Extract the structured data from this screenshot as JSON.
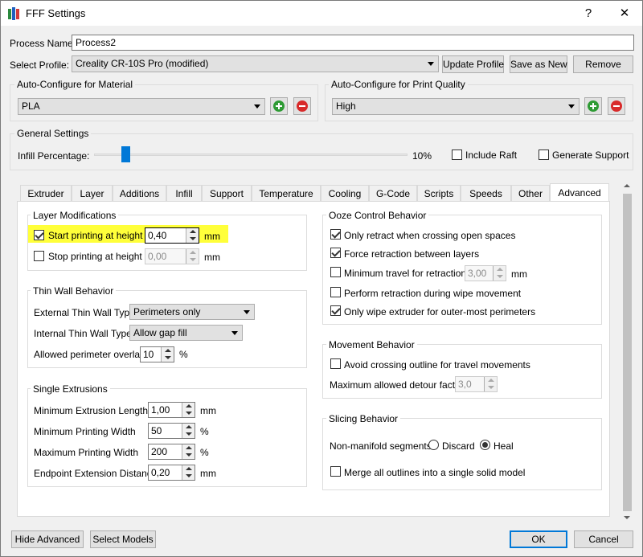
{
  "window": {
    "title": "FFF Settings",
    "help_label": "?",
    "close_label": "✕",
    "icon": "app-logo-icon"
  },
  "process": {
    "name_label": "Process Name:",
    "name_value": "Process2"
  },
  "profile": {
    "label": "Select Profile:",
    "value": "Creality CR-10S Pro (modified)",
    "update_label": "Update Profile",
    "save_as_label": "Save as New",
    "remove_label": "Remove"
  },
  "material": {
    "group_title": "Auto-Configure for Material",
    "value": "PLA"
  },
  "quality": {
    "group_title": "Auto-Configure for Print Quality",
    "value": "High"
  },
  "general": {
    "group_title": "General Settings",
    "infill_label": "Infill Percentage:",
    "infill_value": "10%",
    "infill_fraction": 0.1,
    "raft_label": "Include Raft",
    "raft_checked": false,
    "support_label": "Generate Support",
    "support_checked": false
  },
  "tabs": [
    "Extruder",
    "Layer",
    "Additions",
    "Infill",
    "Support",
    "Temperature",
    "Cooling",
    "G-Code",
    "Scripts",
    "Speeds",
    "Other",
    "Advanced"
  ],
  "active_tab": "Advanced",
  "layer_mod": {
    "title": "Layer Modifications",
    "start_label": "Start printing at height",
    "start_checked": true,
    "start_value": "0,40",
    "stop_label": "Stop printing at height",
    "stop_checked": false,
    "stop_value": "0,00",
    "unit": "mm"
  },
  "thin_wall": {
    "title": "Thin Wall Behavior",
    "external_label": "External Thin Wall Type",
    "external_value": "Perimeters only",
    "internal_label": "Internal Thin Wall Type",
    "internal_value": "Allow gap fill",
    "overlap_label": "Allowed perimeter overlap",
    "overlap_value": "10",
    "overlap_unit": "%"
  },
  "single": {
    "title": "Single Extrusions",
    "rows": [
      {
        "label": "Minimum Extrusion Length",
        "value": "1,00",
        "unit": "mm"
      },
      {
        "label": "Minimum Printing Width",
        "value": "50",
        "unit": "%"
      },
      {
        "label": "Maximum Printing Width",
        "value": "200",
        "unit": "%"
      },
      {
        "label": "Endpoint Extension Distance",
        "value": "0,20",
        "unit": "mm"
      }
    ]
  },
  "ooze": {
    "title": "Ooze Control Behavior",
    "only_retract": "Only retract when crossing open spaces",
    "force_retract": "Force retraction between layers",
    "min_travel": "Minimum travel for retraction",
    "min_travel_value": "3,00",
    "min_travel_unit": "mm",
    "perform_wipe": "Perform retraction during wipe movement",
    "only_wipe": "Only wipe extruder for outer-most perimeters"
  },
  "movement": {
    "title": "Movement Behavior",
    "avoid": "Avoid crossing outline for travel movements",
    "detour_label": "Maximum allowed detour factor",
    "detour_value": "3,0"
  },
  "slicing": {
    "title": "Slicing Behavior",
    "nonmanifold_label": "Non-manifold segments:",
    "discard_label": "Discard",
    "heal_label": "Heal",
    "selected": "Heal",
    "merge_label": "Merge all outlines into a single solid model"
  },
  "footer": {
    "hide_advanced": "Hide Advanced",
    "select_models": "Select Models",
    "ok": "OK",
    "cancel": "Cancel"
  },
  "colors": {
    "highlight": "#ffff3a",
    "accent": "#0078d7"
  }
}
